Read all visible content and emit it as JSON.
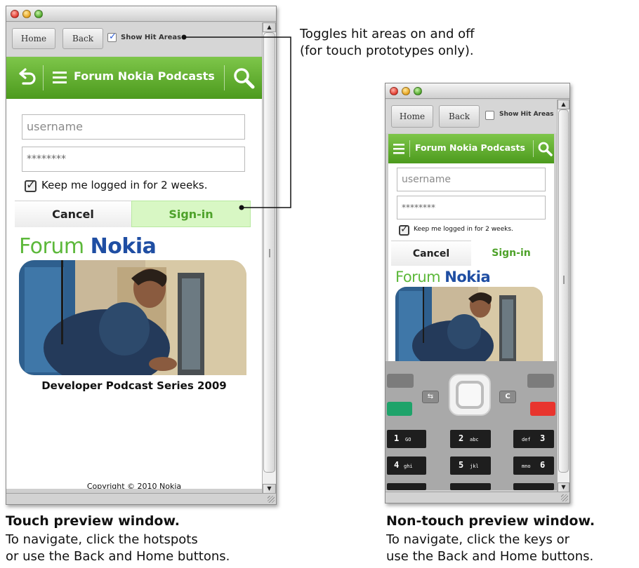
{
  "touch_window": {
    "toolbar": {
      "home_label": "Home",
      "back_label": "Back",
      "show_hit_areas_label": "Show Hit Areas",
      "show_hit_areas_checked": true
    },
    "app_bar": {
      "back_icon": "back-arrow-icon",
      "menu_icon": "menu-icon",
      "title": "Forum Nokia Podcasts",
      "search_icon": "search-icon"
    },
    "login": {
      "username_placeholder": "username",
      "password_value": "********",
      "keep_logged_label": "Keep me logged in for 2 weeks.",
      "keep_logged_checked": true,
      "cancel_label": "Cancel",
      "signin_label": "Sign-in"
    },
    "logo": {
      "part1": "Forum",
      "part2": "Nokia"
    },
    "podcast_caption": "Developer Podcast Series 2009",
    "copyright": "Copyright © 2010 Nokia"
  },
  "nontouch_window": {
    "toolbar": {
      "home_label": "Home",
      "back_label": "Back",
      "show_hit_areas_label": "Show Hit Areas",
      "show_hit_areas_checked": false
    },
    "app_bar": {
      "menu_icon": "menu-icon",
      "title": "Forum Nokia Podcasts",
      "search_icon": "search-icon"
    },
    "login": {
      "username_placeholder": "username",
      "password_value": "********",
      "keep_logged_label": "Keep me logged in for 2 weeks.",
      "keep_logged_checked": true,
      "cancel_label": "Cancel",
      "signin_label": "Sign-in"
    },
    "logo": {
      "part1": "Forum",
      "part2": "Nokia"
    },
    "keypad": {
      "left_soft_key_icon": "menu-key-icon",
      "right_soft_key_label": "C",
      "call_key_color": "#1ea36a",
      "end_key_color": "#e8352e",
      "keys": [
        {
          "digit": "1",
          "letters": "GO"
        },
        {
          "digit": "2",
          "letters": "abc"
        },
        {
          "digit": "3",
          "letters": "def"
        },
        {
          "digit": "4",
          "letters": "ghi"
        },
        {
          "digit": "5",
          "letters": "jkl"
        },
        {
          "digit": "6",
          "letters": "mno"
        }
      ]
    }
  },
  "annotations": {
    "hit_areas_note_line1": "Toggles hit areas on and off",
    "hit_areas_note_line2": "(for touch prototypes only).",
    "touch_caption_title": "Touch preview window.",
    "touch_caption_line1": "To navigate, click the hotspots",
    "touch_caption_line2": "or use the Back and Home buttons.",
    "nontouch_caption_title": "Non-touch preview window.",
    "nontouch_caption_line1": "To navigate, click the keys or",
    "nontouch_caption_line2": "use the Back and Home buttons."
  },
  "colors": {
    "nokia_green": "#5bb134",
    "nokia_blue": "#1f4ea3",
    "signin_highlight": "#d8f7c4"
  }
}
